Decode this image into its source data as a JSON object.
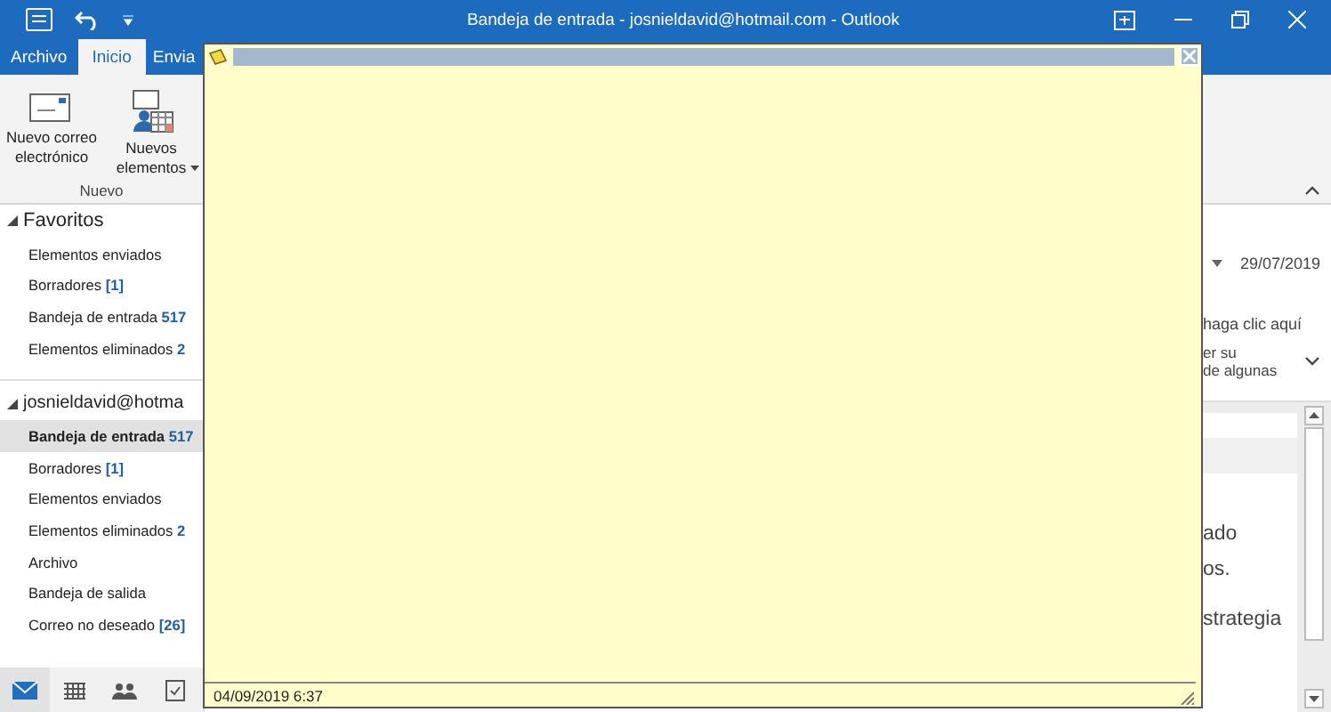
{
  "window": {
    "title": "Bandeja de entrada - josnieldavid@hotmail.com  -  Outlook"
  },
  "tabs": [
    {
      "label": "Archivo",
      "selected": false
    },
    {
      "label": "Inicio",
      "selected": true
    },
    {
      "label": "Envia",
      "selected": false
    }
  ],
  "ribbon": {
    "buttons": [
      {
        "label": "Nuevo correo electrónico",
        "kind": "mail",
        "dropdown": false
      },
      {
        "label": "Nuevos elementos",
        "kind": "items",
        "dropdown": true
      }
    ],
    "group": "Nuevo"
  },
  "favorites": {
    "title": "Favoritos",
    "expanded": true,
    "items": [
      {
        "label": "Elementos enviados",
        "selected": false
      },
      {
        "label": "Borradores",
        "count": "[1]",
        "selected": false
      },
      {
        "label": "Bandeja de entrada",
        "count": "517",
        "selected": false
      },
      {
        "label": "Elementos eliminados",
        "count": "2",
        "selected": false
      }
    ]
  },
  "account": {
    "title": "josnieldavid@hotma",
    "expanded": true,
    "items": [
      {
        "label": "Bandeja de entrada",
        "count": "517",
        "selected": true
      },
      {
        "label": "Borradores",
        "count": "[1]",
        "selected": false
      },
      {
        "label": "Elementos enviados",
        "selected": false
      },
      {
        "label": "Elementos eliminados",
        "count": "2",
        "selected": false
      },
      {
        "label": "Archivo",
        "selected": false
      },
      {
        "label": "Bandeja de salida",
        "selected": false
      },
      {
        "label": "Correo no deseado",
        "count": "[26]",
        "selected": false
      }
    ]
  },
  "nav": [
    {
      "kind": "mail",
      "selected": true
    },
    {
      "kind": "calendar",
      "selected": false
    },
    {
      "kind": "people",
      "selected": false
    },
    {
      "kind": "tasks",
      "selected": false
    }
  ],
  "message": {
    "date": "29/07/2019",
    "info_lines": [
      "haga clic aquí",
      "er su",
      "de algunas"
    ],
    "body_lines": [
      "ado",
      "os.",
      "strategia"
    ]
  },
  "note": {
    "timestamp": "04/09/2019 6:37"
  }
}
